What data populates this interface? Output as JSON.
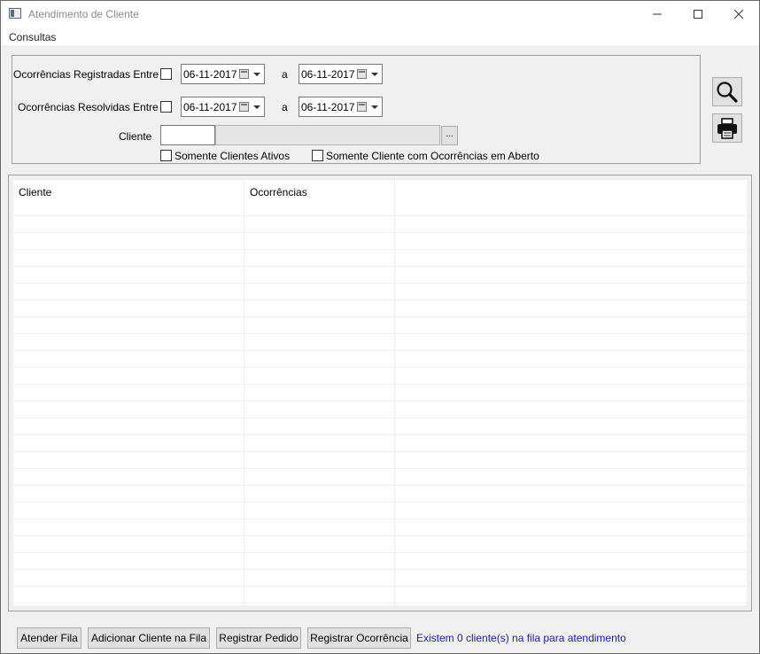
{
  "window": {
    "title": "Atendimento de Cliente",
    "controls": {
      "minimize": "minimize-icon",
      "maximize": "maximize-icon",
      "close": "close-icon"
    }
  },
  "menu": {
    "items": [
      "Consultas"
    ]
  },
  "filters": {
    "registered": {
      "label": "Ocorrências Registradas Entre",
      "checked": false,
      "from": "06-11-2017",
      "to": "06-11-2017",
      "sep": "a"
    },
    "resolved": {
      "label": "Ocorrências Resolvidas Entre",
      "checked": false,
      "from": "06-11-2017",
      "to": "06-11-2017",
      "sep": "a"
    },
    "client": {
      "label": "Cliente",
      "code": "",
      "name": "",
      "lookup_label": "..."
    },
    "only_active": {
      "label": "Somente Clientes Ativos",
      "checked": false
    },
    "only_open": {
      "label": "Somente Cliente com Ocorrências em Aberto",
      "checked": false
    }
  },
  "tools": {
    "search": "search-icon",
    "print": "printer-icon"
  },
  "table": {
    "columns": [
      "Cliente",
      "Ocorrências",
      ""
    ],
    "rows": []
  },
  "footer": {
    "buttons": [
      "Atender Fila",
      "Adicionar Cliente na Fila",
      "Registrar Pedido",
      "Registrar Ocorrência"
    ],
    "status": "Existem 0 cliente(s) na fila para atendimento"
  },
  "colors": {
    "status_text": "#1a1aa6",
    "window_bg": "#f0f0f0"
  }
}
